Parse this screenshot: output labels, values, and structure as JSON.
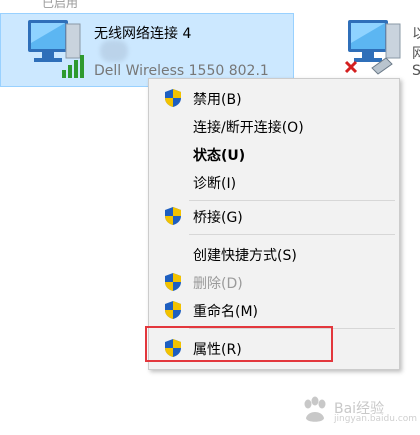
{
  "background": {
    "top_partial_text": "已启用",
    "adapter_selected": {
      "name": "无线网络连接 4",
      "device": "Dell Wireless 1550 802.1"
    },
    "adapter_right_partial_lines": [
      "以",
      "网",
      "S"
    ]
  },
  "context_menu": {
    "items": [
      {
        "label": "禁用(B)",
        "shield": true,
        "style": "normal"
      },
      {
        "label": "连接/断开连接(O)",
        "shield": false,
        "style": "normal"
      },
      {
        "label": "状态(U)",
        "shield": false,
        "style": "bold"
      },
      {
        "label": "诊断(I)",
        "shield": false,
        "style": "normal"
      },
      {
        "label": "桥接(G)",
        "shield": true,
        "style": "normal"
      },
      {
        "label": "创建快捷方式(S)",
        "shield": false,
        "style": "normal"
      },
      {
        "label": "删除(D)",
        "shield": true,
        "style": "disabled"
      },
      {
        "label": "重命名(M)",
        "shield": true,
        "style": "normal"
      },
      {
        "label": "属性(R)",
        "shield": true,
        "style": "normal"
      }
    ]
  },
  "highlight": {
    "color": "#e3373d",
    "target": "属性(R)"
  },
  "watermark": {
    "text": "Bai经验",
    "subtext": "jingyan.baidu.com"
  },
  "colors": {
    "selection_bg": "#cce8ff",
    "menu_bg": "#f2f2f2",
    "shield_blue": "#1e5fc0",
    "shield_yellow": "#f2c200"
  }
}
